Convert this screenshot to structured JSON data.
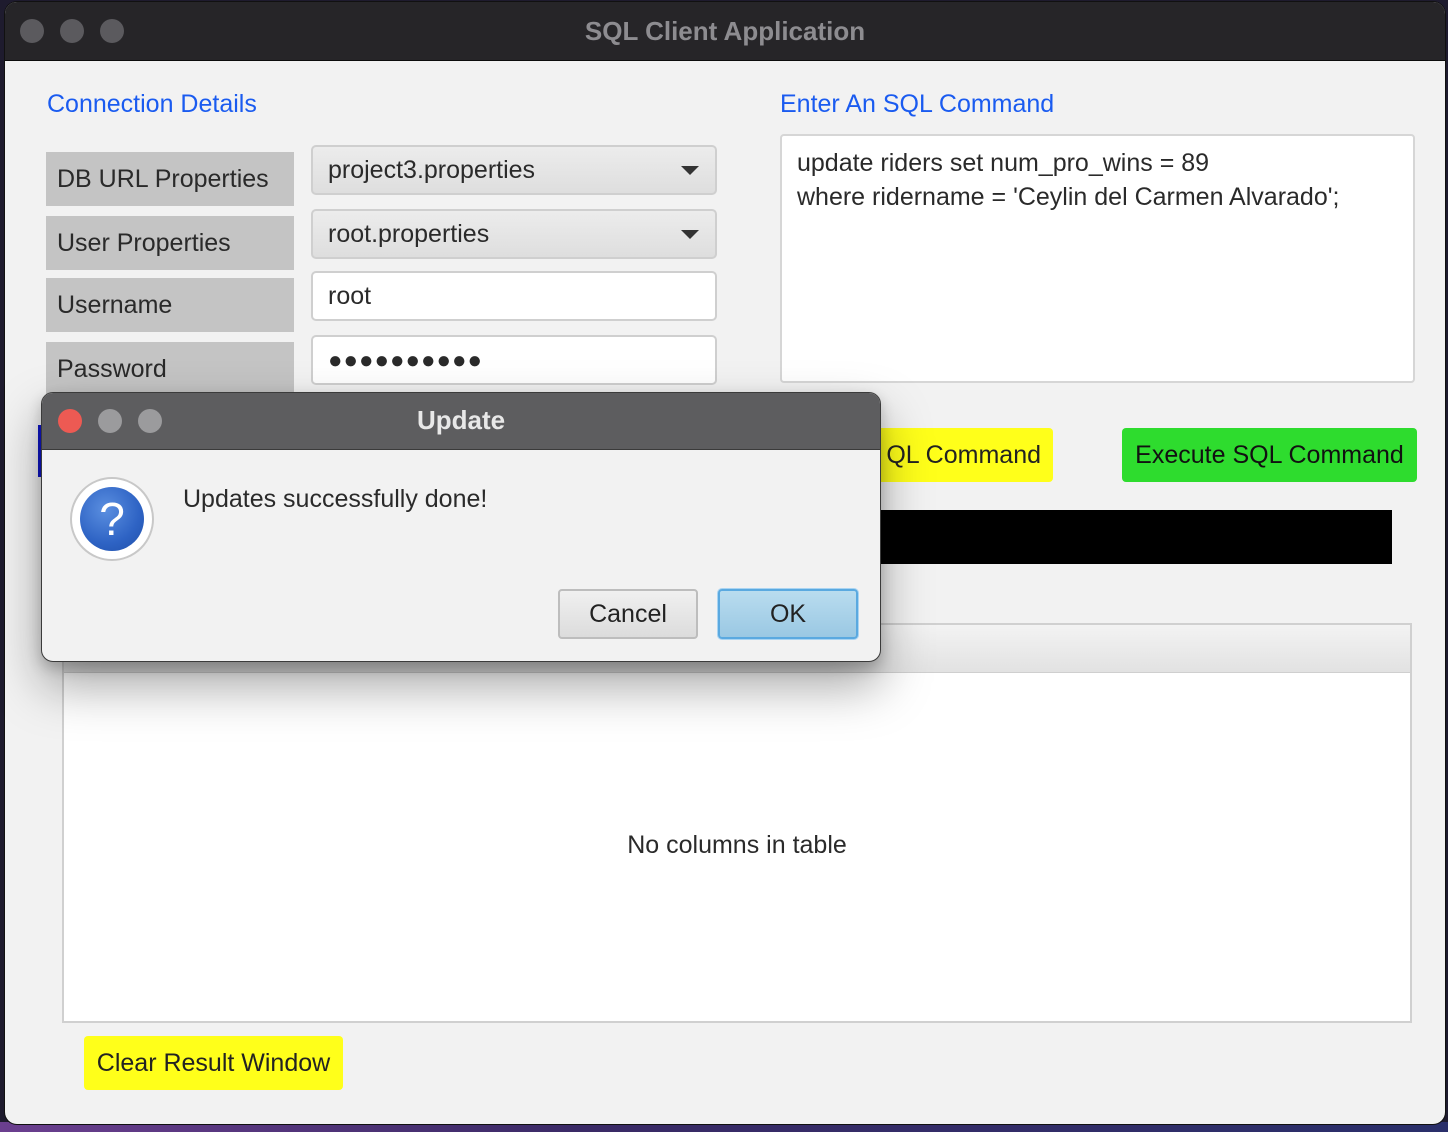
{
  "window": {
    "title": "SQL Client Application"
  },
  "connection": {
    "section_title": "Connection Details",
    "db_url_label": "DB URL Properties",
    "db_url_value": "project3.properties",
    "user_props_label": "User Properties",
    "user_props_value": "root.properties",
    "username_label": "Username",
    "username_value": "root",
    "password_label": "Password",
    "password_value": "●●●●●●●●●●"
  },
  "sql": {
    "section_title": "Enter An SQL Command",
    "line1": "update riders set num_pro_wins = 89",
    "line2": "where ridername = 'Ceylin del Carmen Alvarado';",
    "clear_button_visible": "QL Command",
    "execute_button": "Execute SQL Command"
  },
  "results": {
    "empty_message": "No columns in table",
    "clear_button": "Clear Result Window"
  },
  "dialog": {
    "title": "Update",
    "message": "Updates successfully done!",
    "cancel": "Cancel",
    "ok": "OK",
    "icon": "question-icon"
  },
  "colors": {
    "accent_blue": "#1a5bf0",
    "yellow_button": "#ffff1a",
    "green_button": "#2edc2e"
  }
}
